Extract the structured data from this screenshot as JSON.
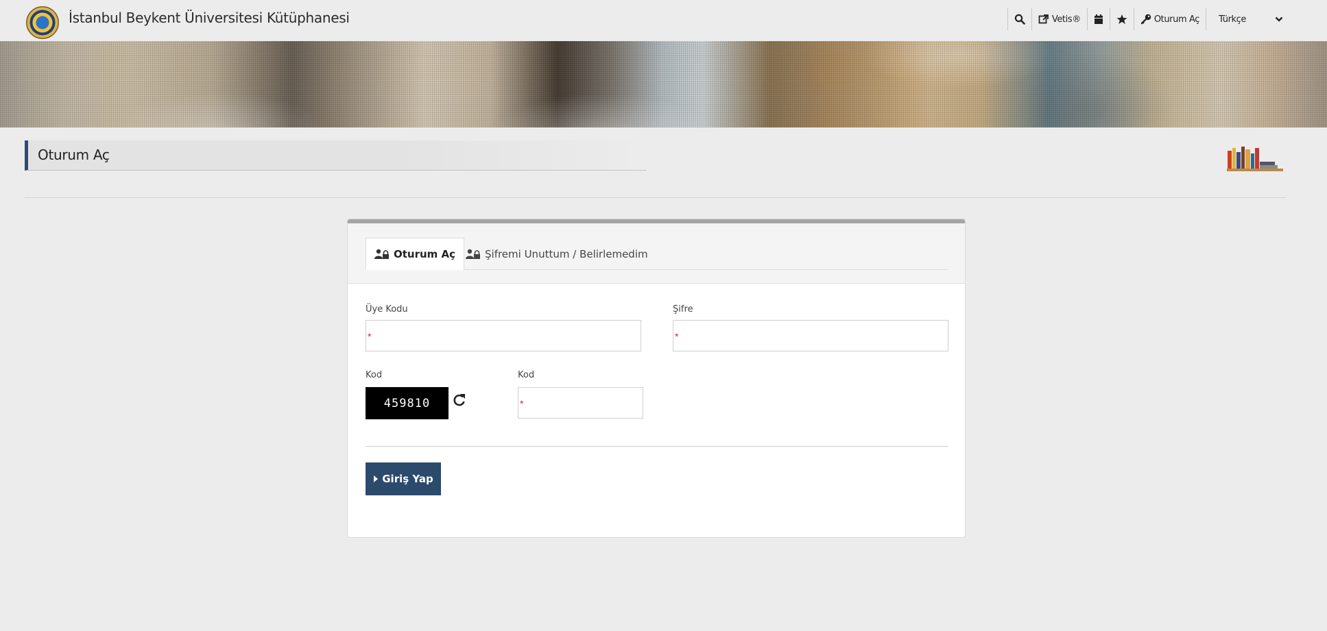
{
  "header": {
    "site_title": "İstanbul Beykent Üniversitesi Kütüphanesi",
    "nav": {
      "vetis_label": "Vetis®",
      "login_label": "Oturum Aç",
      "language": "Türkçe"
    }
  },
  "page": {
    "title": "Oturum Aç"
  },
  "login": {
    "tabs": [
      {
        "label": "Oturum Aç",
        "active": true
      },
      {
        "label": "Şifremi Unuttum / Belirlemedim",
        "active": false
      }
    ],
    "member_code_label": "Üye Kodu",
    "password_label": "Şifre",
    "captcha_label": "Kod",
    "captcha_value": "459810",
    "code_input_label": "Kod",
    "required_mark": "*",
    "submit_label": "Giriş Yap"
  },
  "colors": {
    "accent": "#2c4a6b",
    "required": "#d0233d",
    "background": "#ececec"
  },
  "icons": [
    "search-icon",
    "external-link-icon",
    "calendar-icon",
    "star-icon",
    "key-icon",
    "chevron-down-icon",
    "users-lock-icon",
    "refresh-icon",
    "caret-right-icon",
    "books-icon"
  ]
}
